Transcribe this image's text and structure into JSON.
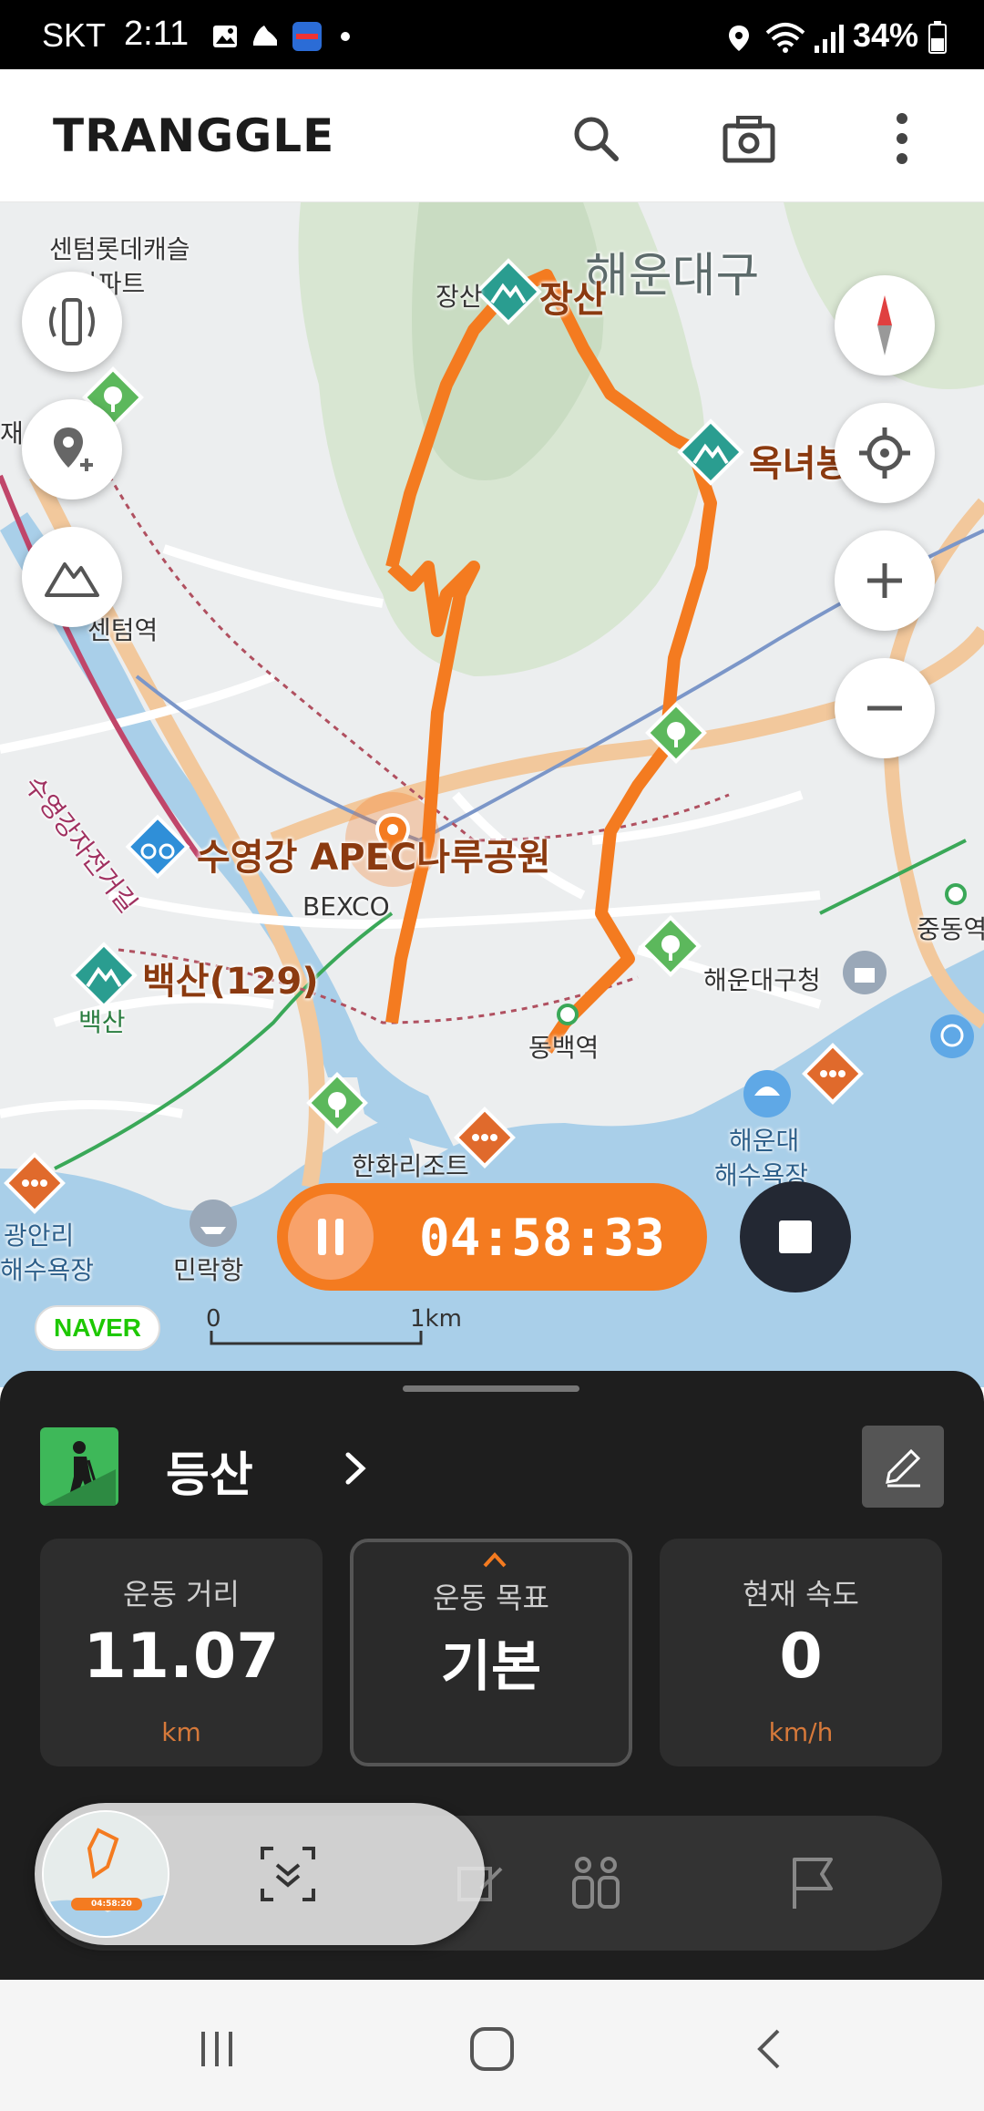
{
  "status_bar": {
    "carrier": "SKT",
    "time": "2:11",
    "battery": "34%",
    "icons": [
      "image-icon",
      "shoe-icon",
      "app-icon",
      "dot-icon",
      "location-icon",
      "wifi-icon",
      "signal-icon",
      "battery-icon"
    ]
  },
  "header": {
    "logo": "TRANGGLE",
    "actions": [
      "search-icon",
      "camera-icon",
      "more-vert-icon"
    ]
  },
  "map": {
    "labels": {
      "district": "해운대구",
      "jangsan": "장산",
      "jangsan_prefix": "장산",
      "oknyeo": "옥녀봉",
      "centum_apt_line1": "센텀롯데캐슬",
      "centum_apt_line2": "아파트",
      "jae": "재",
      "centum_station": "센텀역",
      "suyeong_bike": "수영강자전거길",
      "park": "수영강 APEC나루공원",
      "bexco": "BEXCO",
      "baeksan": "백산(129)",
      "baeksan_sub": "백산",
      "haeundae_office": "해운대구청",
      "jungdong": "중동역",
      "dongbaek": "동백역",
      "haeundae_beach_line1": "해운대",
      "haeundae_beach_line2": "해수욕장",
      "hanwha": "한화리조트",
      "gwangalli_line1": "광안리",
      "gwangalli_line2": "해수욕장",
      "millak": "민락항"
    },
    "controls": [
      "signal-toggle-icon",
      "add-place-icon",
      "mountain-icon",
      "compass-icon",
      "my-location-icon",
      "zoom-in-icon",
      "zoom-out-icon"
    ],
    "naver": "NAVER",
    "scale_zero": "0",
    "scale_unit": "1km"
  },
  "recording": {
    "elapsed": "04:58:33"
  },
  "activity": {
    "name": "등산",
    "stats": [
      {
        "label": "운동 거리",
        "value": "11.07",
        "unit": "km"
      },
      {
        "label": "운동 목표",
        "value": "기본",
        "unit": ""
      },
      {
        "label": "현재 속도",
        "value": "0",
        "unit": "km/h"
      }
    ],
    "mini_timer": "04:58:20"
  },
  "colors": {
    "accent": "#F47B20",
    "route": "#F47B20",
    "sheet_bg": "#1E1E1E",
    "hiking_green": "#3EB859"
  }
}
